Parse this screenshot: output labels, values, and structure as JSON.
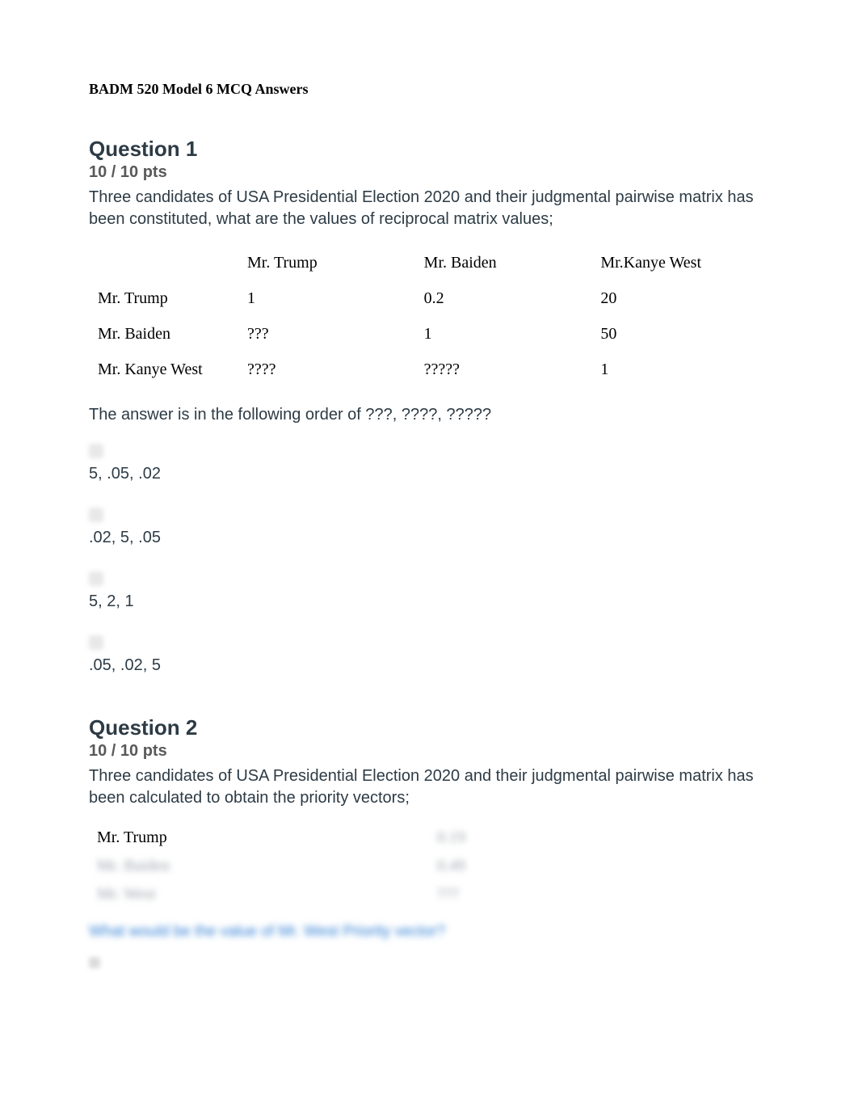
{
  "doc_title": "BADM 520 Model 6 MCQ Answers",
  "q1": {
    "title": "Question 1",
    "points": "10 / 10 pts",
    "text": "Three candidates of USA Presidential Election 2020 and their judgmental pairwise matrix has been constituted, what are the values of reciprocal matrix values;",
    "matrix": {
      "header": [
        "",
        "Mr. Trump",
        "Mr. Baiden",
        "Mr.Kanye West"
      ],
      "rows": [
        [
          "Mr. Trump",
          "1",
          "0.2",
          "20"
        ],
        [
          "Mr. Baiden",
          "???",
          "1",
          "50"
        ],
        [
          "Mr. Kanye West",
          "????",
          "?????",
          "1"
        ]
      ]
    },
    "answer_note": "The answer is in the following order of ???, ????, ?????",
    "options": [
      "5, .05, .02",
      ".02, 5, .05",
      "5, 2, 1",
      ".05, .02, 5"
    ]
  },
  "q2": {
    "title": "Question 2",
    "points": "10 / 10 pts",
    "text": "Three candidates of USA Presidential Election 2020 and their judgmental pairwise matrix has been calculated to obtain the priority vectors;",
    "pv_table": {
      "rows": [
        [
          "Mr. Trump",
          "0.19"
        ],
        [
          "Mr. Baiden",
          "0.49"
        ],
        [
          "Mr. West",
          "???"
        ]
      ]
    },
    "followup": "What would be the value of Mr. West Priority vector?"
  }
}
